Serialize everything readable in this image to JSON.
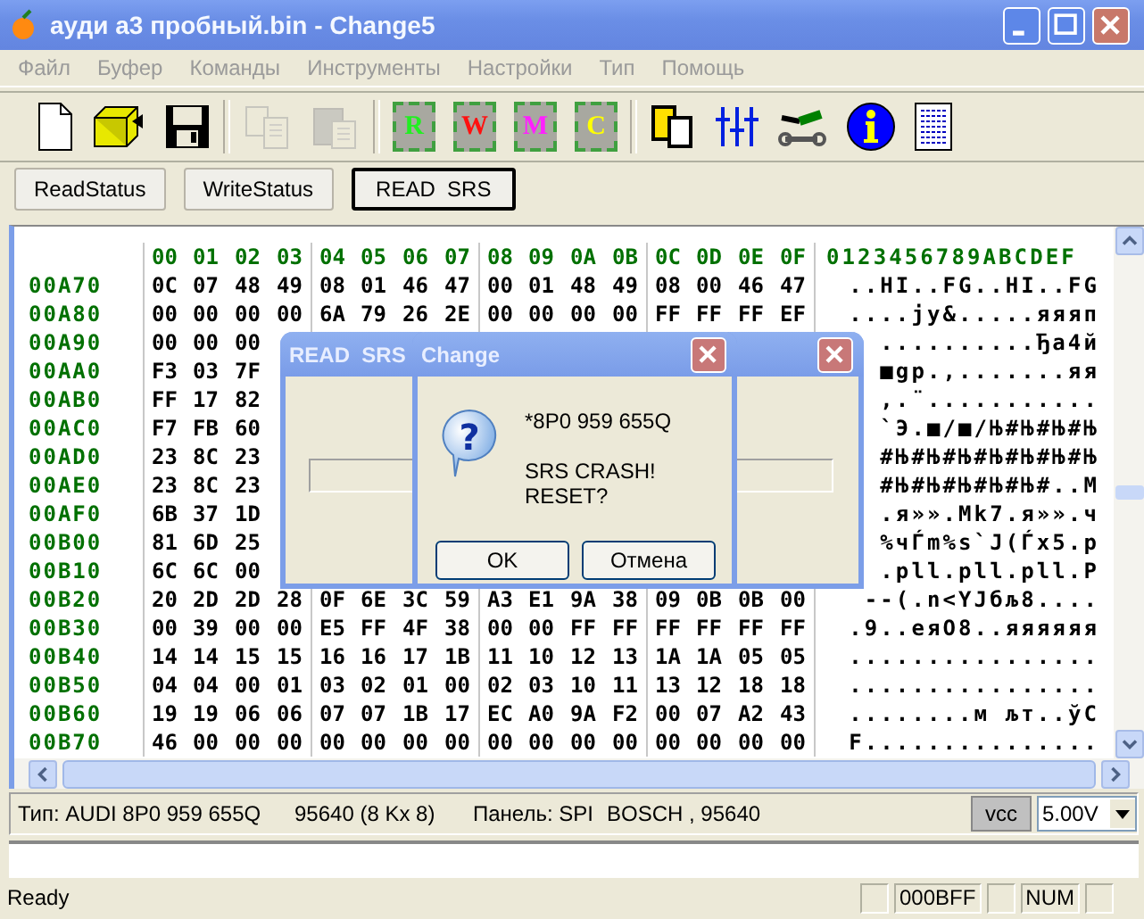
{
  "window": {
    "title": "ауди а3 пробный.bin - Change5"
  },
  "menu": [
    "Файл",
    "Буфер",
    "Команды",
    "Инструменты",
    "Настройки",
    "Тип",
    "Помощь"
  ],
  "toolbar": [
    {
      "kind": "new",
      "disabled": false
    },
    {
      "kind": "open",
      "disabled": false
    },
    {
      "kind": "save",
      "disabled": false
    },
    {
      "kind": "separator"
    },
    {
      "kind": "copy",
      "disabled": true
    },
    {
      "kind": "paste",
      "disabled": true
    },
    {
      "kind": "separator"
    },
    {
      "kind": "chip",
      "label": "R",
      "color": "#22ee22",
      "disabled": false
    },
    {
      "kind": "chip",
      "label": "W",
      "color": "#ff1010",
      "disabled": false
    },
    {
      "kind": "chip",
      "label": "M",
      "color": "#ff20ff",
      "disabled": false
    },
    {
      "kind": "chip",
      "label": "C",
      "color": "#ffff00",
      "disabled": false
    },
    {
      "kind": "separator"
    },
    {
      "kind": "chips",
      "disabled": false
    },
    {
      "kind": "sliders",
      "disabled": false
    },
    {
      "kind": "tools",
      "disabled": false
    },
    {
      "kind": "info",
      "disabled": false
    },
    {
      "kind": "document",
      "disabled": false
    }
  ],
  "actions": [
    {
      "label": "ReadStatus",
      "focused": false
    },
    {
      "label": "WriteStatus",
      "focused": false
    },
    {
      "label": "READ  SRS",
      "focused": true
    }
  ],
  "hex": {
    "columns": [
      "00",
      "01",
      "02",
      "03",
      "04",
      "05",
      "06",
      "07",
      "08",
      "09",
      "0A",
      "0B",
      "0C",
      "0D",
      "0E",
      "0F"
    ],
    "ascii_header": "0123456789ABCDEF",
    "rows": [
      {
        "address": "00A70",
        "bytes": [
          "0C",
          "07",
          "48",
          "49",
          "08",
          "01",
          "46",
          "47",
          "00",
          "01",
          "48",
          "49",
          "08",
          "00",
          "46",
          "47"
        ],
        "ascii": "..HI..FG..HI..FG"
      },
      {
        "address": "00A80",
        "bytes": [
          "00",
          "00",
          "00",
          "00",
          "6A",
          "79",
          "26",
          "2E",
          "00",
          "00",
          "00",
          "00",
          "FF",
          "FF",
          "FF",
          "EF"
        ],
        "ascii": "....jy&.....яяяп"
      },
      {
        "address": "00A90",
        "bytes": [
          "00",
          "00",
          "00"
        ],
        "ascii": "..........Ђа4й"
      },
      {
        "address": "00AA0",
        "bytes": [
          "F3",
          "03",
          "7F"
        ],
        "ascii": "■gp.,.......яя"
      },
      {
        "address": "00AB0",
        "bytes": [
          "FF",
          "17",
          "82"
        ],
        "ascii": "‚.¨..........."
      },
      {
        "address": "00AC0",
        "bytes": [
          "F7",
          "FB",
          "60"
        ],
        "ascii": "`Э.■/■/Њ#Њ#Њ#Њ"
      },
      {
        "address": "00AD0",
        "bytes": [
          "23",
          "8C",
          "23"
        ],
        "ascii": "#Њ#Њ#Њ#Њ#Њ#Њ#Њ"
      },
      {
        "address": "00AE0",
        "bytes": [
          "23",
          "8C",
          "23"
        ],
        "ascii": "#Њ#Њ#Њ#Њ#Њ#..М"
      },
      {
        "address": "00AF0",
        "bytes": [
          "6B",
          "37",
          "1D"
        ],
        "ascii": ".я»».Mk7.я»».ч"
      },
      {
        "address": "00B00",
        "bytes": [
          "81",
          "6D",
          "25"
        ],
        "ascii": "%чЃm%s`J(Ѓx5.p"
      },
      {
        "address": "00B10",
        "bytes": [
          "6C",
          "6C",
          "00"
        ],
        "ascii": ".pll.pll.pll.P"
      },
      {
        "address": "00B20",
        "bytes": [
          "20",
          "2D",
          "2D",
          "28",
          "0F",
          "6E",
          "3C",
          "59",
          "A3",
          "E1",
          "9A",
          "38",
          "09",
          "0B",
          "0B",
          "00"
        ],
        "ascii": " --(.n<YЈбљ8...."
      },
      {
        "address": "00B30",
        "bytes": [
          "00",
          "39",
          "00",
          "00",
          "E5",
          "FF",
          "4F",
          "38",
          "00",
          "00",
          "FF",
          "FF",
          "FF",
          "FF",
          "FF",
          "FF"
        ],
        "ascii": ".9..еяO8..яяяяяя"
      },
      {
        "address": "00B40",
        "bytes": [
          "14",
          "14",
          "15",
          "15",
          "16",
          "16",
          "17",
          "1B",
          "11",
          "10",
          "12",
          "13",
          "1A",
          "1A",
          "05",
          "05"
        ],
        "ascii": "................"
      },
      {
        "address": "00B50",
        "bytes": [
          "04",
          "04",
          "00",
          "01",
          "03",
          "02",
          "01",
          "00",
          "02",
          "03",
          "10",
          "11",
          "13",
          "12",
          "18",
          "18"
        ],
        "ascii": "................"
      },
      {
        "address": "00B60",
        "bytes": [
          "19",
          "19",
          "06",
          "06",
          "07",
          "07",
          "1B",
          "17",
          "EC",
          "A0",
          "9A",
          "F2",
          "00",
          "07",
          "A2",
          "43"
        ],
        "ascii": "........м љт..ўC"
      },
      {
        "address": "00B70",
        "bytes": [
          "46",
          "00",
          "00",
          "00",
          "00",
          "00",
          "00",
          "00",
          "00",
          "00",
          "00",
          "00",
          "00",
          "00",
          "00",
          "00"
        ],
        "ascii": "F..............."
      }
    ]
  },
  "dialogs": [
    {
      "kind": "progress",
      "title": "READ  SRS"
    },
    {
      "kind": "question",
      "title": "Change",
      "icon": "?",
      "lines": [
        "*8P0 959 655Q",
        "SRS CRASH!",
        "RESET?"
      ],
      "buttons": [
        "OK",
        "Отмена"
      ]
    }
  ],
  "info_bar": {
    "type": "Тип: AUDI 8P0 959 655Q",
    "chip": "95640 (8 Kx 8)",
    "panel": "Панель: SPI",
    "maker": "BOSCH , 95640",
    "vcc_button": "vcc",
    "voltage": "5.00V"
  },
  "status_bar": {
    "text": "Ready",
    "panes": [
      "000BFF",
      "NUM"
    ]
  }
}
